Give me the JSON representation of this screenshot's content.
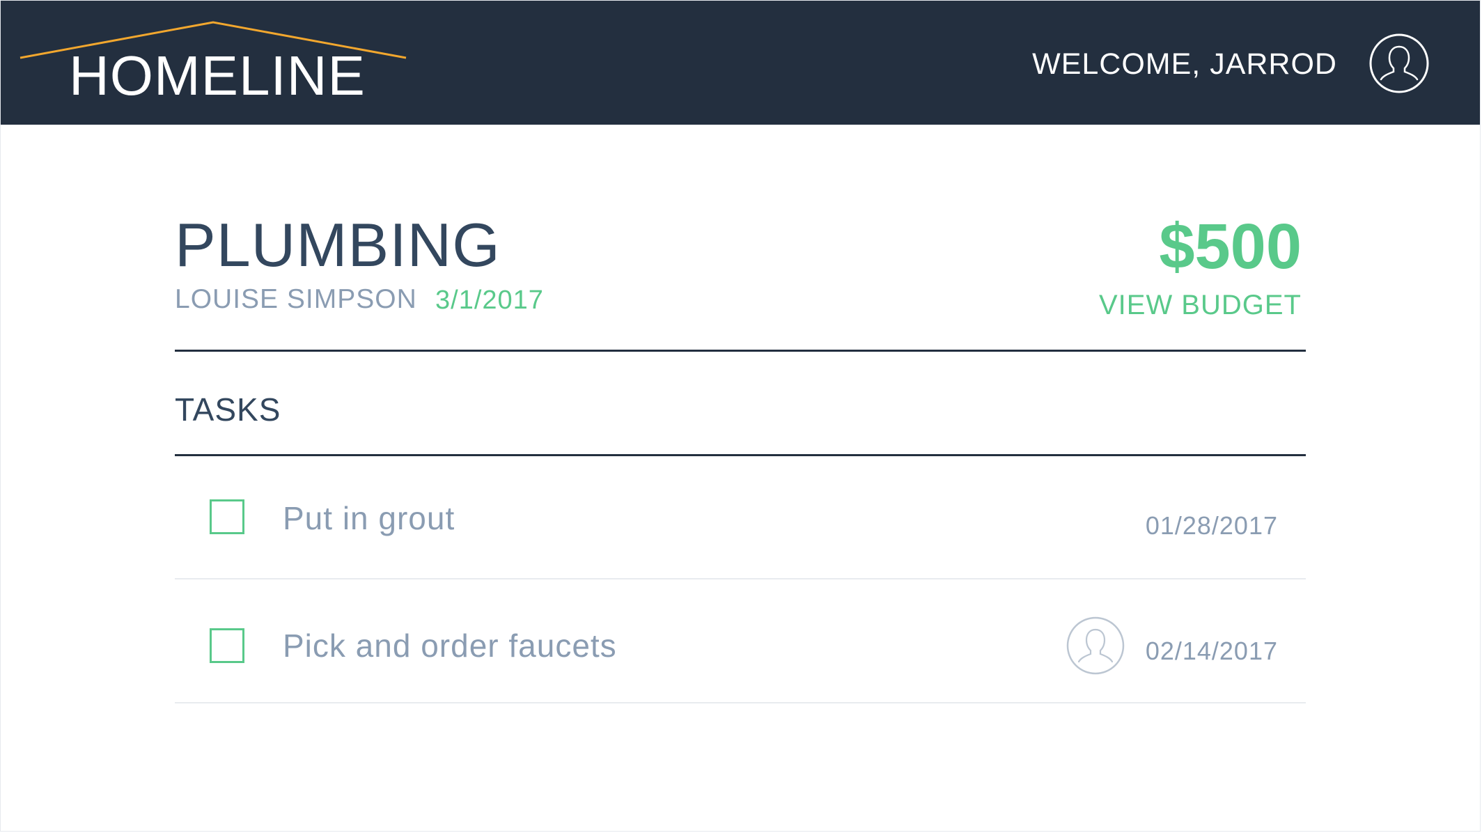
{
  "header": {
    "logo_text": "HOMELINE",
    "welcome_text": "WELCOME, JARROD",
    "avatar_icon": "user-avatar-icon",
    "background_color": "#232f3f",
    "logo_roof_color": "#f2a72e"
  },
  "project": {
    "title": "PLUMBING",
    "owner": "LOUISE SIMPSON",
    "date": "3/1/2017",
    "amount": "$500",
    "view_budget_label": "VIEW BUDGET",
    "accent_color": "#59c98a"
  },
  "tasks": {
    "heading": "TASKS",
    "items": [
      {
        "label": "Put in grout",
        "due_date": "01/28/2017",
        "checked": false,
        "assignee_icon": null
      },
      {
        "label": "Pick and order faucets",
        "due_date": "02/14/2017",
        "checked": false,
        "assignee_icon": "user-avatar-icon"
      }
    ]
  }
}
